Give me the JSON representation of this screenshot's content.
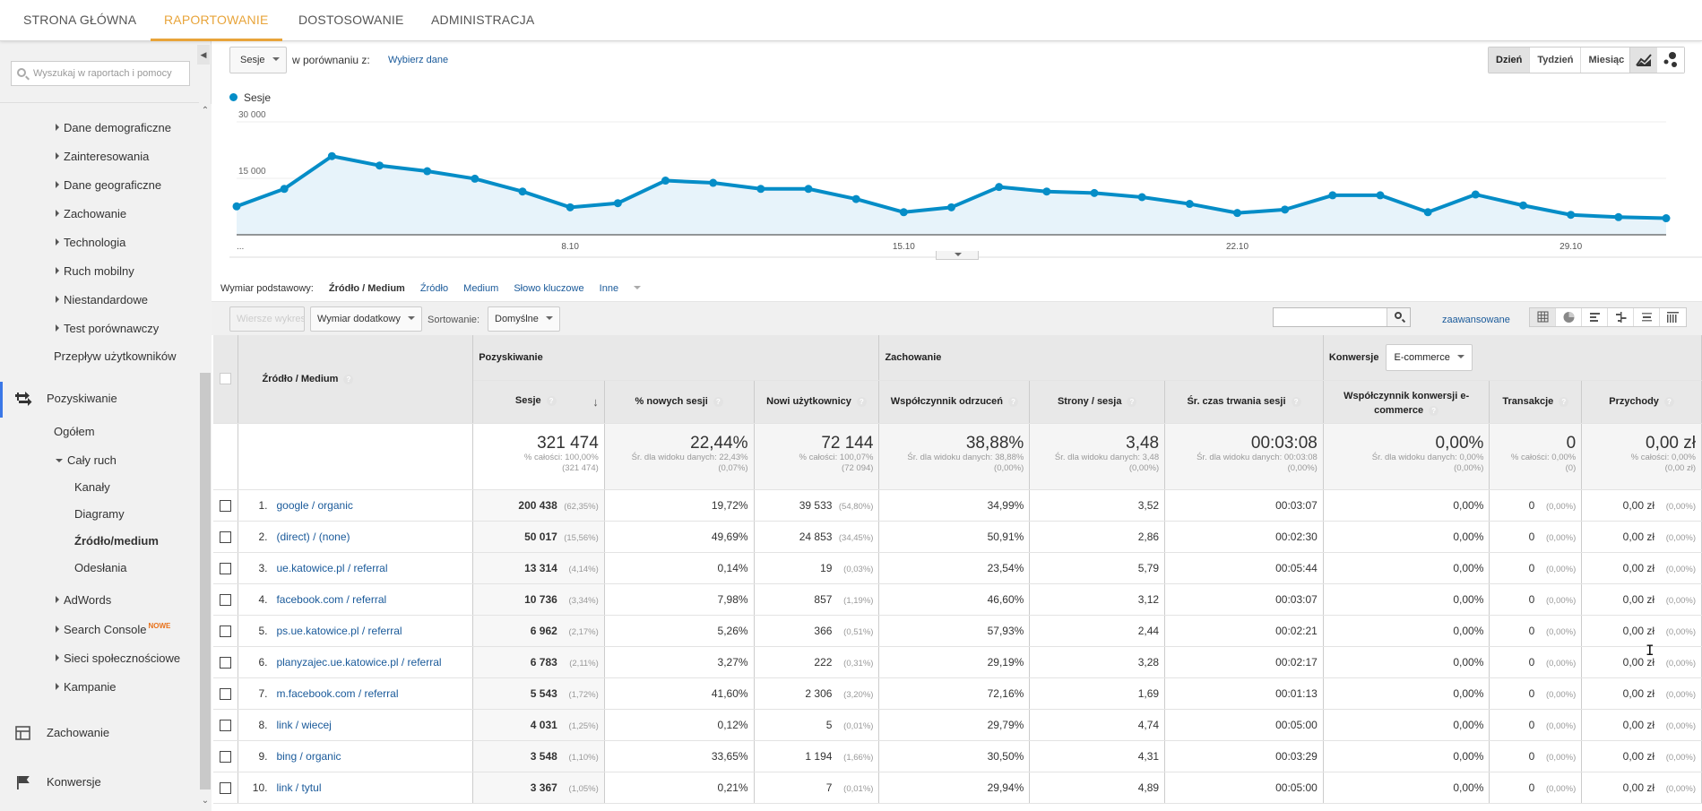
{
  "top_nav": {
    "tabs": [
      {
        "label": "STRONA GŁÓWNA",
        "active": false
      },
      {
        "label": "RAPORTOWANIE",
        "active": true
      },
      {
        "label": "DOSTOSOWANIE",
        "active": false
      },
      {
        "label": "ADMINISTRACJA",
        "active": false
      }
    ],
    "accent_color": "#e8a43a"
  },
  "sidebar": {
    "search_placeholder": "Wyszukaj w raportach i pomocy",
    "audience_subitems": [
      "Dane demograficzne",
      "Zainteresowania",
      "Dane geograficzne",
      "Zachowanie",
      "Technologia",
      "Ruch mobilny",
      "Niestandardowe",
      "Test porównawczy"
    ],
    "users_flow": "Przepływ użytkowników",
    "acquisition": {
      "label": "Pozyskiwanie",
      "overview": "Ogółem",
      "all_traffic": "Cały ruch",
      "all_traffic_items": [
        "Kanały",
        "Diagramy",
        "Źródło/medium",
        "Odesłania"
      ],
      "active_item": "Źródło/medium",
      "adwords": "AdWords",
      "search_console": "Search Console",
      "new_badge": "NOWE",
      "social": "Sieci społecznościowe",
      "campaigns": "Kampanie"
    },
    "behavior": "Zachowanie",
    "conversions": "Konwersje"
  },
  "chart_controls": {
    "metric": "Sesje",
    "compare_label": "w porównaniu z:",
    "compare_link": "Wybierz dane",
    "periods": [
      {
        "label": "Dzień",
        "active": true
      },
      {
        "label": "Tydzień",
        "active": false
      },
      {
        "label": "Miesiąc",
        "active": false
      }
    ]
  },
  "chart_data": {
    "type": "area",
    "title": "",
    "legend": [
      {
        "name": "Sesje",
        "color": "#058dc7"
      }
    ],
    "legend_position": "top-left",
    "xlabel": "",
    "ylabel": "",
    "ylim": [
      0,
      30000
    ],
    "yticks": [
      {
        "value": 15000,
        "label": "15 000"
      },
      {
        "value": 30000,
        "label": "30 000"
      }
    ],
    "xticks": [
      {
        "day": 1,
        "label": "..."
      },
      {
        "day": 8,
        "label": "8.10"
      },
      {
        "day": 15,
        "label": "15.10"
      },
      {
        "day": 22,
        "label": "22.10"
      },
      {
        "day": 29,
        "label": "29.10"
      }
    ],
    "grid": true,
    "series": [
      {
        "name": "Sesje",
        "x": [
          1,
          2,
          3,
          4,
          5,
          6,
          7,
          8,
          9,
          10,
          11,
          12,
          13,
          14,
          15,
          16,
          17,
          18,
          19,
          20,
          21,
          22,
          23,
          24,
          25,
          26,
          27,
          28,
          29,
          30,
          31
        ],
        "values": [
          7550,
          12200,
          20900,
          18400,
          16900,
          14900,
          11500,
          7300,
          8400,
          14400,
          13800,
          12200,
          12200,
          9500,
          6000,
          7300,
          12700,
          11500,
          11100,
          10000,
          8200,
          5800,
          6700,
          10500,
          10500,
          6000,
          10700,
          7800,
          5300,
          4700,
          4400
        ]
      }
    ]
  },
  "dimension_bar": {
    "label": "Wymiar podstawowy:",
    "current": "Źródło / Medium",
    "options": [
      "Źródło",
      "Medium",
      "Słowo kluczowe",
      "Inne"
    ]
  },
  "toolbar": {
    "plot_rows": "Wiersze wykresu",
    "secondary_dim": "Wymiar dodatkowy",
    "sort_label": "Sortowanie:",
    "sort_value": "Domyślne",
    "search_value": "",
    "advanced": "zaawansowane"
  },
  "table": {
    "dim_header": "Źródło / Medium",
    "groups": {
      "acquisition": "Pozyskiwanie",
      "behavior": "Zachowanie",
      "conversions": "Konwersje",
      "conversions_select": "E-commerce"
    },
    "columns": [
      "Sesje",
      "% nowych sesji",
      "Nowi użytkownicy",
      "Współczynnik odrzuceń",
      "Strony / sesja",
      "Śr. czas trwania sesji",
      "Współczynnik konwersji e-commerce",
      "Transakcje",
      "Przychody"
    ],
    "totals": [
      {
        "value": "321 474",
        "sub1": "% całości: 100,00%",
        "sub2": "(321 474)"
      },
      {
        "value": "22,44%",
        "sub1": "Śr. dla widoku danych: 22,43%",
        "sub2": "(0,07%)"
      },
      {
        "value": "72 144",
        "sub1": "% całości: 100,07%",
        "sub2": "(72 094)"
      },
      {
        "value": "38,88%",
        "sub1": "Śr. dla widoku danych: 38,88%",
        "sub2": "(0,00%)"
      },
      {
        "value": "3,48",
        "sub1": "Śr. dla widoku danych: 3,48",
        "sub2": "(0,00%)"
      },
      {
        "value": "00:03:08",
        "sub1": "Śr. dla widoku danych: 00:03:08",
        "sub2": "(0,00%)"
      },
      {
        "value": "0,00%",
        "sub1": "Śr. dla widoku danych: 0,00%",
        "sub2": "(0,00%)"
      },
      {
        "value": "0",
        "sub1": "% całości: 0,00%",
        "sub2": "(0)"
      },
      {
        "value": "0,00 zł",
        "sub1": "% całości: 0,00%",
        "sub2": "(0,00 zł)"
      }
    ],
    "rows": [
      {
        "n": "1.",
        "dim": "google / organic",
        "sessions": "200 438",
        "sessions_pct": "(62,35%)",
        "new_pct": "19,72%",
        "new_users": "39 533",
        "new_users_pct": "(54,80%)",
        "bounce": "34,99%",
        "pages": "3,52",
        "duration": "00:03:07",
        "conv": "0,00%",
        "trans": "0",
        "trans_pct": "(0,00%)",
        "rev": "0,00 zł",
        "rev_pct": "(0,00%)"
      },
      {
        "n": "2.",
        "dim": "(direct) / (none)",
        "sessions": "50 017",
        "sessions_pct": "(15,56%)",
        "new_pct": "49,69%",
        "new_users": "24 853",
        "new_users_pct": "(34,45%)",
        "bounce": "50,91%",
        "pages": "2,86",
        "duration": "00:02:30",
        "conv": "0,00%",
        "trans": "0",
        "trans_pct": "(0,00%)",
        "rev": "0,00 zł",
        "rev_pct": "(0,00%)"
      },
      {
        "n": "3.",
        "dim": "ue.katowice.pl / referral",
        "sessions": "13 314",
        "sessions_pct": "(4,14%)",
        "new_pct": "0,14%",
        "new_users": "19",
        "new_users_pct": "(0,03%)",
        "bounce": "23,54%",
        "pages": "5,79",
        "duration": "00:05:44",
        "conv": "0,00%",
        "trans": "0",
        "trans_pct": "(0,00%)",
        "rev": "0,00 zł",
        "rev_pct": "(0,00%)"
      },
      {
        "n": "4.",
        "dim": "facebook.com / referral",
        "sessions": "10 736",
        "sessions_pct": "(3,34%)",
        "new_pct": "7,98%",
        "new_users": "857",
        "new_users_pct": "(1,19%)",
        "bounce": "46,60%",
        "pages": "3,12",
        "duration": "00:03:07",
        "conv": "0,00%",
        "trans": "0",
        "trans_pct": "(0,00%)",
        "rev": "0,00 zł",
        "rev_pct": "(0,00%)"
      },
      {
        "n": "5.",
        "dim": "ps.ue.katowice.pl / referral",
        "sessions": "6 962",
        "sessions_pct": "(2,17%)",
        "new_pct": "5,26%",
        "new_users": "366",
        "new_users_pct": "(0,51%)",
        "bounce": "57,93%",
        "pages": "2,44",
        "duration": "00:02:21",
        "conv": "0,00%",
        "trans": "0",
        "trans_pct": "(0,00%)",
        "rev": "0,00 zł",
        "rev_pct": "(0,00%)"
      },
      {
        "n": "6.",
        "dim": "planyzajec.ue.katowice.pl / referral",
        "sessions": "6 783",
        "sessions_pct": "(2,11%)",
        "new_pct": "3,27%",
        "new_users": "222",
        "new_users_pct": "(0,31%)",
        "bounce": "29,19%",
        "pages": "3,28",
        "duration": "00:02:17",
        "conv": "0,00%",
        "trans": "0",
        "trans_pct": "(0,00%)",
        "rev": "0,00 zł",
        "rev_pct": "(0,00%)"
      },
      {
        "n": "7.",
        "dim": "m.facebook.com / referral",
        "sessions": "5 543",
        "sessions_pct": "(1,72%)",
        "new_pct": "41,60%",
        "new_users": "2 306",
        "new_users_pct": "(3,20%)",
        "bounce": "72,16%",
        "pages": "1,69",
        "duration": "00:01:13",
        "conv": "0,00%",
        "trans": "0",
        "trans_pct": "(0,00%)",
        "rev": "0,00 zł",
        "rev_pct": "(0,00%)"
      },
      {
        "n": "8.",
        "dim": "link / wiecej",
        "sessions": "4 031",
        "sessions_pct": "(1,25%)",
        "new_pct": "0,12%",
        "new_users": "5",
        "new_users_pct": "(0,01%)",
        "bounce": "29,79%",
        "pages": "4,74",
        "duration": "00:05:00",
        "conv": "0,00%",
        "trans": "0",
        "trans_pct": "(0,00%)",
        "rev": "0,00 zł",
        "rev_pct": "(0,00%)"
      },
      {
        "n": "9.",
        "dim": "bing / organic",
        "sessions": "3 548",
        "sessions_pct": "(1,10%)",
        "new_pct": "33,65%",
        "new_users": "1 194",
        "new_users_pct": "(1,66%)",
        "bounce": "30,50%",
        "pages": "4,31",
        "duration": "00:03:29",
        "conv": "0,00%",
        "trans": "0",
        "trans_pct": "(0,00%)",
        "rev": "0,00 zł",
        "rev_pct": "(0,00%)"
      },
      {
        "n": "10.",
        "dim": "link / tytul",
        "sessions": "3 367",
        "sessions_pct": "(1,05%)",
        "new_pct": "0,21%",
        "new_users": "7",
        "new_users_pct": "(0,01%)",
        "bounce": "29,94%",
        "pages": "4,89",
        "duration": "00:05:00",
        "conv": "0,00%",
        "trans": "0",
        "trans_pct": "(0,00%)",
        "rev": "0,00 zł",
        "rev_pct": "(0,00%)"
      }
    ]
  },
  "icons": {
    "search": "search-icon",
    "acquisition": "acquisition-arrows-icon",
    "behavior": "behavior-layout-icon",
    "conversions": "flag-icon",
    "help": "?"
  }
}
